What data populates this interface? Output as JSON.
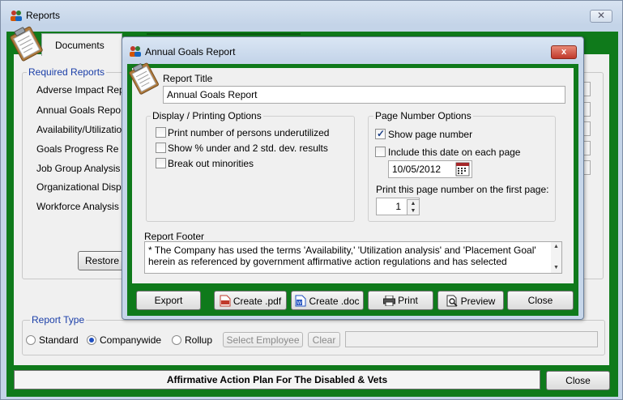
{
  "window": {
    "title": "Reports",
    "close_glyph": "✕"
  },
  "tabs": [
    {
      "label": "Documents"
    }
  ],
  "required_reports": {
    "title": "Required Reports",
    "items": [
      "Adverse Impact Rep",
      "Annual Goals Repo",
      "Availability/Utilizatio",
      "Goals Progress Re",
      "Job Group Analysis",
      "Organizational Disp",
      "Workforce Analysis"
    ],
    "restore_label": "Restore"
  },
  "report_type": {
    "title": "Report Type",
    "options": [
      {
        "label": "Standard",
        "selected": false
      },
      {
        "label": "Companywide",
        "selected": true
      },
      {
        "label": "Rollup",
        "selected": false
      }
    ],
    "select_employee_label": "Select Employee",
    "clear_label": "Clear",
    "employee_value": ""
  },
  "status_bar": {
    "text": "Affirmative Action Plan For The Disabled & Vets"
  },
  "main_close_label": "Close",
  "dialog": {
    "title": "Annual Goals Report",
    "close_glyph": "x",
    "report_title_label": "Report Title",
    "report_title_value": "Annual Goals Report",
    "display_options": {
      "title": "Display / Printing Options",
      "items": [
        {
          "label": "Print number of persons underutilized",
          "checked": false
        },
        {
          "label": "Show % under and 2 std. dev. results",
          "checked": false
        },
        {
          "label": "Break out minorities",
          "checked": false
        }
      ]
    },
    "page_options": {
      "title": "Page Number Options",
      "show_page_number": {
        "label": "Show page number",
        "checked": true
      },
      "include_date": {
        "label": "Include this date on each page",
        "checked": false
      },
      "date_value": "10/05/2012",
      "first_page_label": "Print this page number on the first page:",
      "first_page_value": "1"
    },
    "footer_label": "Report Footer",
    "footer_text": "* The Company has used the terms 'Availability,' 'Utilization analysis' and 'Placement Goal' herein as referenced by government affirmative action regulations and has selected",
    "buttons": {
      "export": "Export",
      "create_pdf": "Create .pdf",
      "create_doc": "Create .doc",
      "print": "Print",
      "preview": "Preview",
      "close": "Close"
    }
  },
  "colors": {
    "frame_green": "#0f7a1b",
    "link_blue": "#1a3ea8",
    "close_red": "#c0392b"
  }
}
